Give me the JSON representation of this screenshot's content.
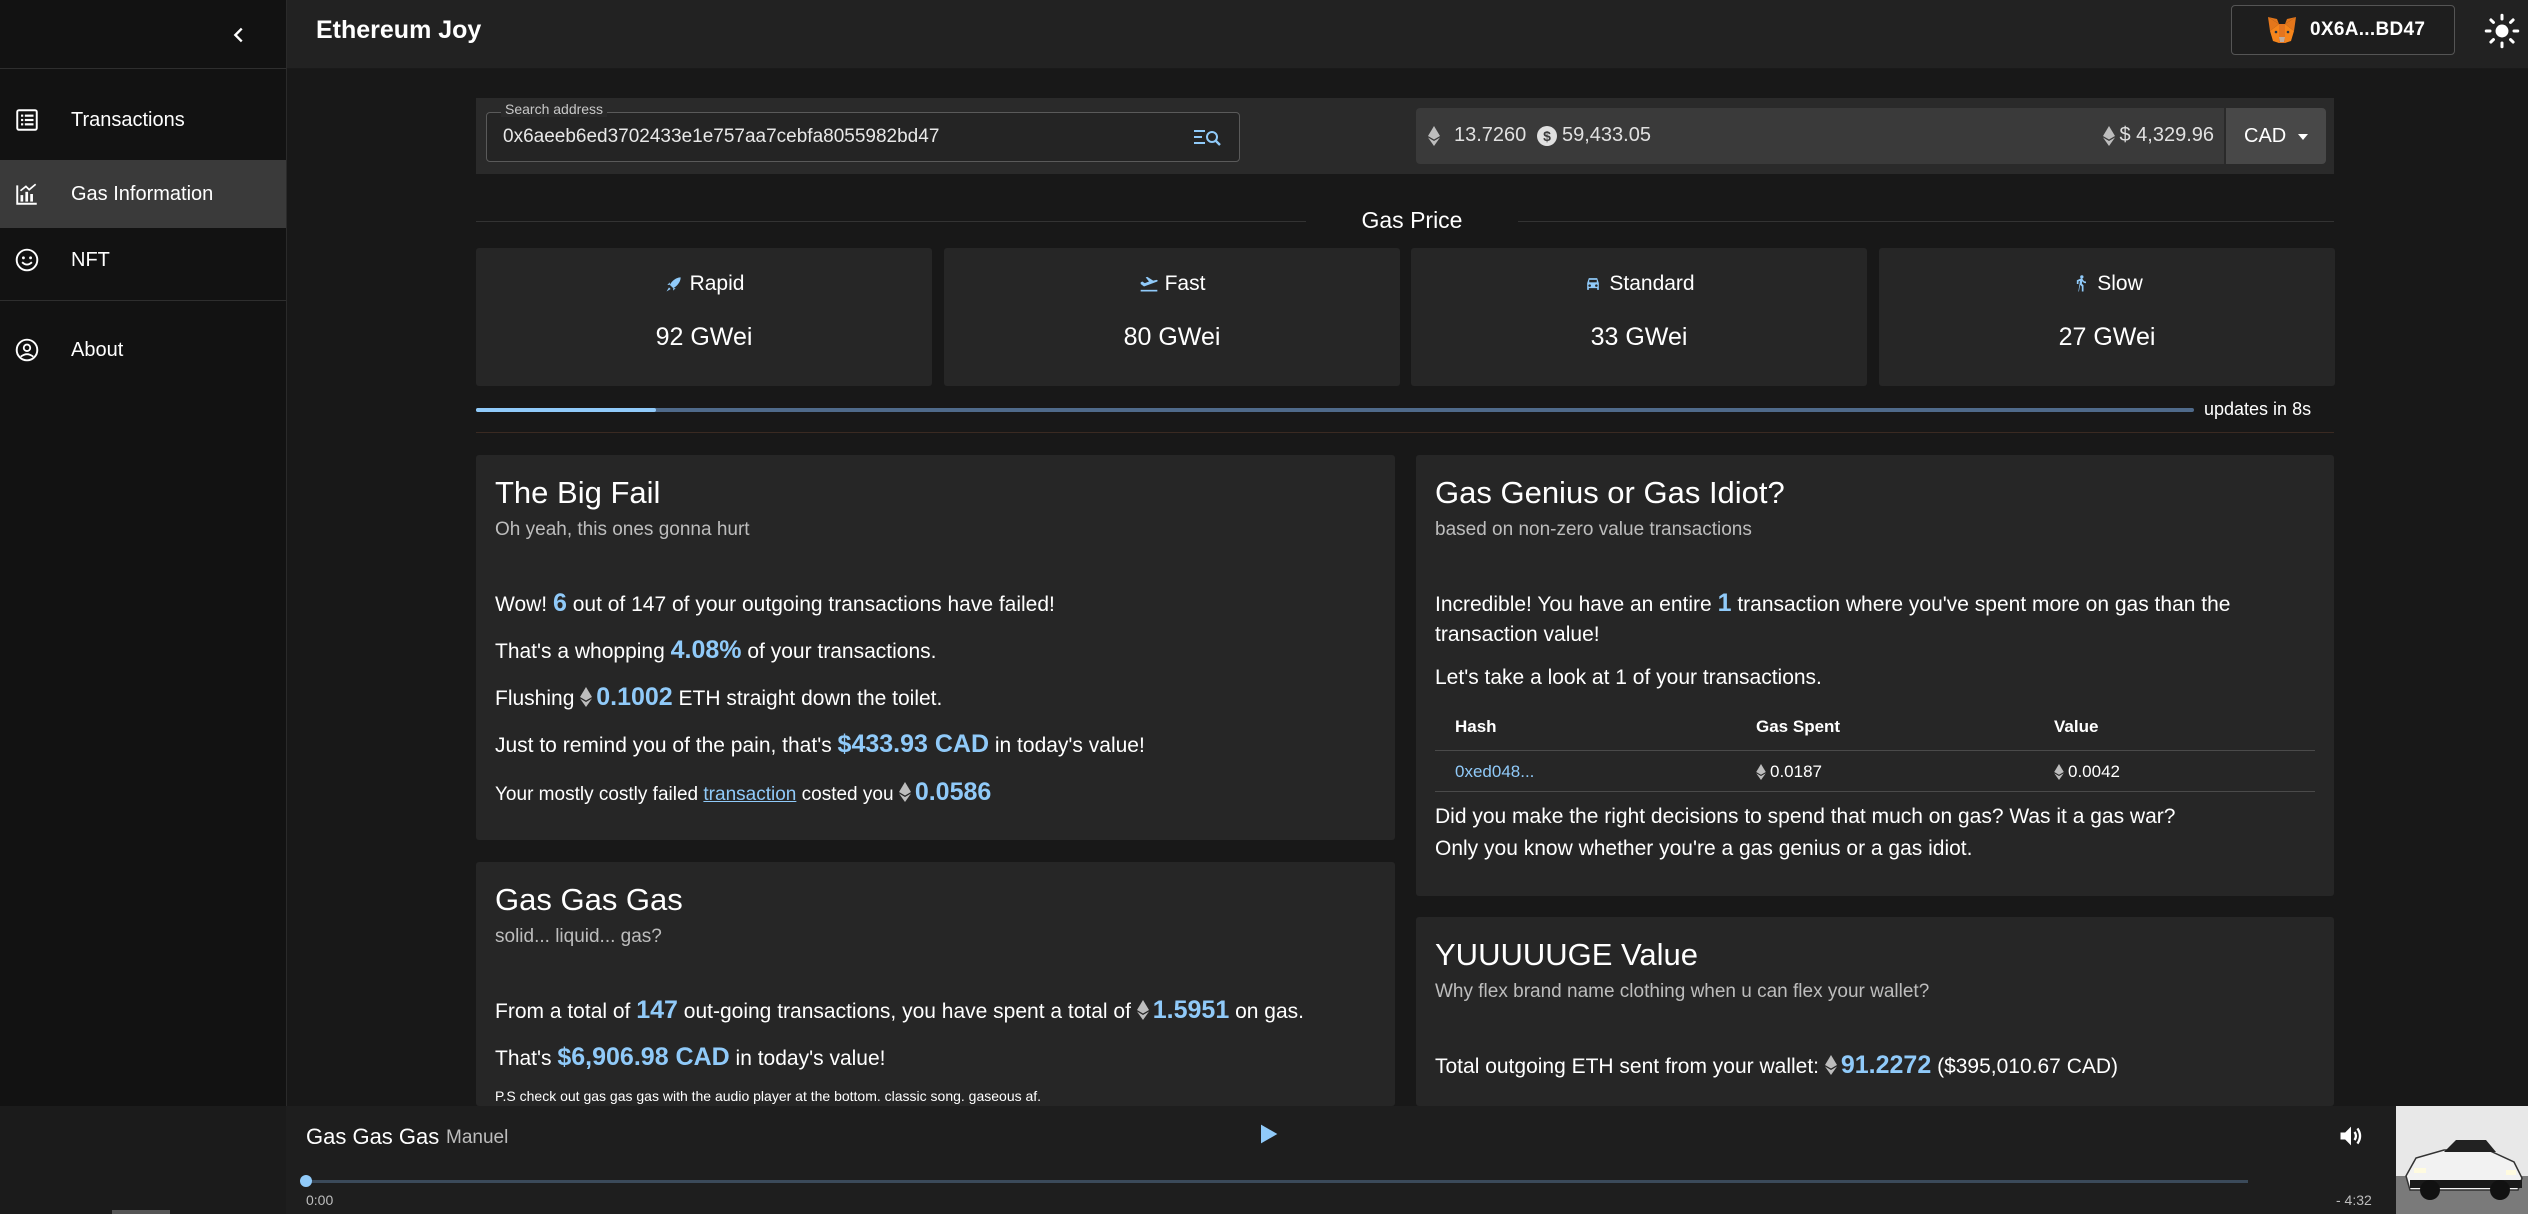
{
  "app": {
    "title": "Ethereum Joy"
  },
  "wallet": {
    "address": "0X6A...BD47"
  },
  "sidebar": {
    "items": [
      {
        "label": "Transactions",
        "icon": "list-icon"
      },
      {
        "label": "Gas Information",
        "icon": "chart-icon",
        "active": true
      },
      {
        "label": "NFT",
        "icon": "smiley-icon"
      },
      {
        "label": "About",
        "icon": "account-circle-icon"
      }
    ]
  },
  "search": {
    "label": "Search address",
    "value": "0x6aeeb6ed3702433e1e757aa7cebfa8055982bd47"
  },
  "balance": {
    "eth": "13.7260",
    "usd": "59,433.05",
    "eth_price": "$ 4,329.96",
    "currency": "CAD"
  },
  "gas_price": {
    "title": "Gas Price",
    "tiers": [
      {
        "label": "Rapid",
        "value": "92 GWei",
        "icon": "rocket-icon"
      },
      {
        "label": "Fast",
        "value": "80 GWei",
        "icon": "plane-icon"
      },
      {
        "label": "Standard",
        "value": "33 GWei",
        "icon": "car-icon"
      },
      {
        "label": "Slow",
        "value": "27 GWei",
        "icon": "walk-icon"
      }
    ],
    "update_progress": 0.105,
    "update_label": "updates in 8s"
  },
  "big_fail": {
    "title": "The Big Fail",
    "subtitle": "Oh yeah, this ones gonna hurt",
    "l1_a": "Wow!",
    "l1_failed": "6",
    "l1_b": "out of 147 of your outgoing transactions have failed!",
    "l2_a": "That's a whopping",
    "l2_pct": "4.08%",
    "l2_b": "of your transactions.",
    "l3_a": "Flushing",
    "l3_eth": "0.1002",
    "l3_b": "ETH straight down the toilet.",
    "l4_a": "Just to remind you of the pain, that's",
    "l4_val": "$433.93 CAD",
    "l4_b": "in today's value!",
    "l5_a": "Your mostly costly failed",
    "l5_link": "transaction",
    "l5_b": "costed you",
    "l5_eth": "0.0586"
  },
  "gas_genius": {
    "title": "Gas Genius or Gas Idiot?",
    "subtitle": "based on non-zero value transactions",
    "l1_a": "Incredible! You have an entire",
    "l1_count": "1",
    "l1_b": "transaction where you've spent more on gas than the",
    "l1_c": "transaction value!",
    "l2": "Let's take a look at 1 of your transactions.",
    "table": {
      "headers": [
        "Hash",
        "Gas Spent",
        "Value"
      ],
      "rows": [
        {
          "hash": "0xed048...",
          "gas": "0.0187",
          "value": "0.0042"
        }
      ]
    },
    "l3": "Did you make the right decisions to spend that much on gas? Was it a gas war?",
    "l4": "Only you know whether you're a gas genius or a gas idiot."
  },
  "gas_gas_gas": {
    "title": "Gas Gas Gas",
    "subtitle": "solid... liquid... gas?",
    "l1_a": "From a total of",
    "l1_count": "147",
    "l1_b": "out-going transactions, you have spent a total of",
    "l1_eth": "1.5951",
    "l1_c": "on gas.",
    "l2_a": "That's",
    "l2_val": "$6,906.98 CAD",
    "l2_b": "in today's value!",
    "l3": "P.S check out gas gas gas with the audio player at the bottom. classic song. gaseous af."
  },
  "yuge": {
    "title": "YUUUUUGE Value",
    "subtitle": "Why flex brand name clothing when u can flex your wallet?",
    "l1_a": "Total outgoing ETH sent from your wallet:",
    "l1_eth": "91.2272",
    "l1_b": "($395,010.67 CAD)"
  },
  "player": {
    "title": "Gas Gas Gas",
    "artist": "Manuel",
    "time_start": "0:00",
    "time_end": "- 4:32",
    "progress": 0
  },
  "colors": {
    "accent": "#90caf9",
    "background": "#181818",
    "card": "#262626",
    "sidebar": "#121212"
  }
}
